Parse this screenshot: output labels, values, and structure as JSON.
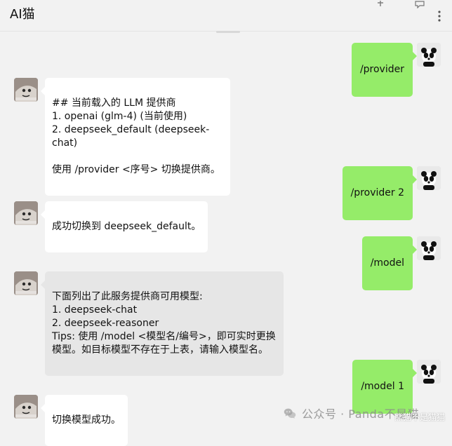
{
  "app": {
    "title": "AI猫"
  },
  "messages": [
    {
      "side": "right",
      "text": "/provider"
    },
    {
      "side": "left",
      "text": "## 当前载入的 LLM 提供商\n1. openai (glm-4) (当前使用)\n2. deepseek_default (deepseek-chat)\n\n使用 /provider <序号> 切换提供商。"
    },
    {
      "side": "right",
      "text": "/provider 2"
    },
    {
      "side": "left",
      "text": "成功切换到 deepseek_default。"
    },
    {
      "side": "right",
      "text": "/model"
    },
    {
      "side": "left",
      "highlighted": true,
      "text": "下面列出了此服务提供商可用模型:\n1. deepseek-chat\n2. deepseek-reasoner\nTips: 使用 /model <模型名/编号>，即可实时更换模型。如目标模型不存在于上表，请输入模型名。"
    },
    {
      "side": "right",
      "text": "/model 1"
    },
    {
      "side": "left",
      "text": "切换模型成功。"
    }
  ],
  "watermark": {
    "text": "公众号 · Panda不是猫"
  },
  "corner_tag": {
    "text": "熊猫不是猫猫"
  },
  "colors": {
    "bg": "#f2f2f2",
    "bubble_left": "#ffffff",
    "bubble_left_highlight": "#e6e6e6",
    "bubble_right": "#95ec69"
  },
  "icons": {
    "pin": "pin-icon",
    "message": "message-icon",
    "more": "more-vertical-icon",
    "wechat": "wechat-icon"
  }
}
